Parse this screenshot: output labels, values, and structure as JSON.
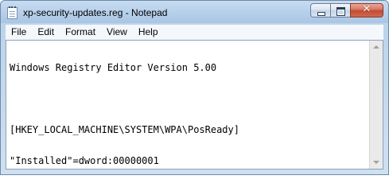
{
  "window": {
    "title": "xp-security-updates.reg - Notepad",
    "app_icon": "notepad-icon",
    "caption_buttons": {
      "minimize": "minimize-icon",
      "maximize": "maximize-icon",
      "close": "close-icon",
      "close_glyph": "✕"
    }
  },
  "menu": {
    "items": [
      "File",
      "Edit",
      "Format",
      "View",
      "Help"
    ]
  },
  "document": {
    "lines": [
      "Windows Registry Editor Version 5.00",
      "",
      "[HKEY_LOCAL_MACHINE\\SYSTEM\\WPA\\PosReady]",
      "\"Installed\"=dword:00000001"
    ]
  },
  "colors": {
    "close_button": "#c24a33",
    "frame": "#b7d0ea"
  }
}
